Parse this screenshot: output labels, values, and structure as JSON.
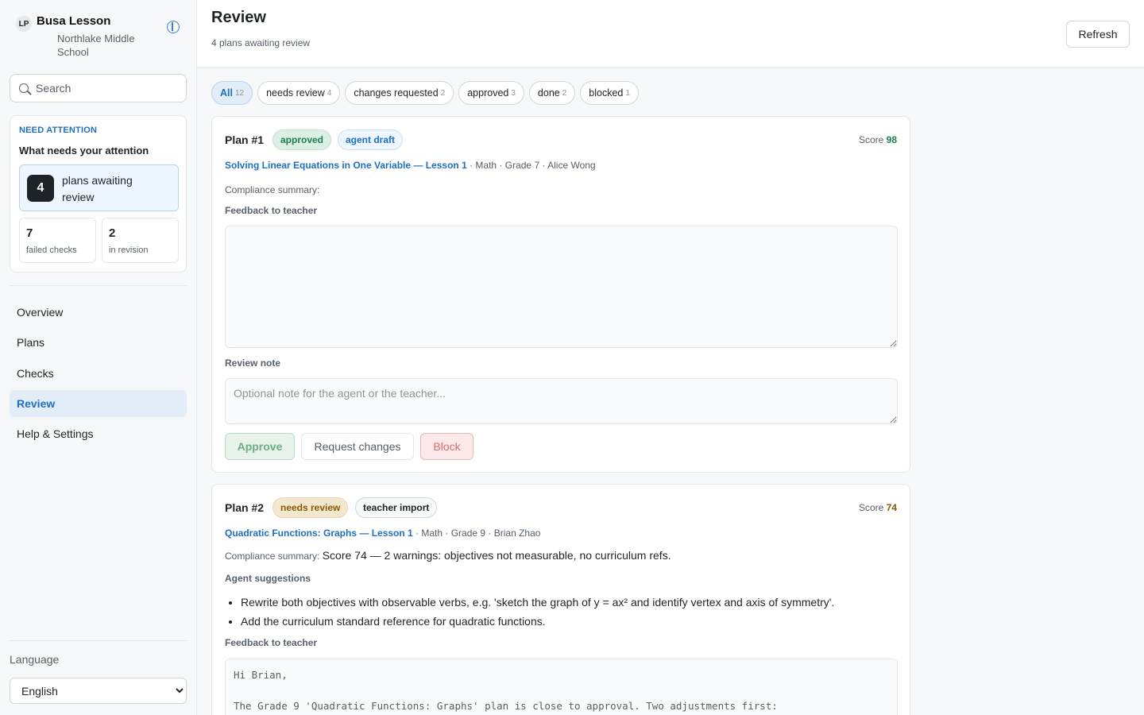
{
  "brand": {
    "logo": "LP",
    "name": "Busa Lesson",
    "school": "Northlake Middle School"
  },
  "search": {
    "placeholder": "Search"
  },
  "attention": {
    "kicker": "NEED ATTENTION",
    "title": "What needs your attention",
    "main": {
      "count": "4",
      "label": "plans awaiting review"
    },
    "stats": [
      {
        "count": "7",
        "label": "failed checks"
      },
      {
        "count": "2",
        "label": "in revision"
      }
    ]
  },
  "nav": {
    "items": [
      {
        "label": "Overview"
      },
      {
        "label": "Plans"
      },
      {
        "label": "Checks"
      },
      {
        "label": "Review",
        "active": true
      },
      {
        "label": "Help & Settings"
      }
    ]
  },
  "language": {
    "label": "Language",
    "selected": "English"
  },
  "header": {
    "title": "Review",
    "subtitle": "4 plans awaiting review",
    "refresh_label": "Refresh"
  },
  "filters": [
    {
      "label": "All",
      "count": "12",
      "active": true
    },
    {
      "label": "needs review",
      "count": "4"
    },
    {
      "label": "changes requested",
      "count": "2"
    },
    {
      "label": "approved",
      "count": "3"
    },
    {
      "label": "done",
      "count": "2"
    },
    {
      "label": "blocked",
      "count": "1"
    }
  ],
  "plans": [
    {
      "title": "Plan #1",
      "status": "approved",
      "source": "agent draft",
      "score_label": "Score",
      "score": "98",
      "link": "Solving Linear Equations in One Variable — Lesson 1",
      "meta": " · Math · Grade 7 · Alice Wong",
      "compliance_label": "Compliance summary:",
      "compliance_value": "",
      "feedback_label": "Feedback to teacher",
      "feedback_value": "",
      "review_note_label": "Review note",
      "review_note_placeholder": "Optional note for the agent or the teacher...",
      "approve_label": "Approve",
      "changes_label": "Request changes",
      "block_label": "Block"
    },
    {
      "title": "Plan #2",
      "status": "needs review",
      "source": "teacher import",
      "score_label": "Score",
      "score": "74",
      "link": "Quadratic Functions: Graphs — Lesson 1",
      "meta": " · Math · Grade 9 · Brian Zhao",
      "compliance_label": "Compliance summary:",
      "compliance_value": "Score 74 — 2 warnings: objectives not measurable, no curriculum refs.",
      "suggestions_label": "Agent suggestions",
      "suggestions": [
        "Rewrite both objectives with observable verbs, e.g. 'sketch the graph of y = ax² and identify vertex and axis of symmetry'.",
        "Add the curriculum standard reference for quadratic functions."
      ],
      "feedback_label": "Feedback to teacher",
      "feedback_value": "Hi Brian,\n\nThe Grade 9 'Quadratic Functions: Graphs' plan is close to approval. Two adjustments first:"
    }
  ]
}
